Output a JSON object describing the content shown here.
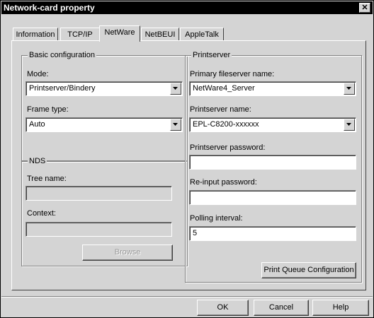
{
  "window": {
    "title": "Network-card property",
    "close_label": "✕"
  },
  "tabs": [
    {
      "label": "Information"
    },
    {
      "label": "TCP/IP"
    },
    {
      "label": "NetWare"
    },
    {
      "label": "NetBEUI"
    },
    {
      "label": "AppleTalk"
    }
  ],
  "active_tab": "NetWare",
  "basic": {
    "group_label": "Basic configuration",
    "mode_label": "Mode:",
    "mode_value": "Printserver/Bindery",
    "frame_label": "Frame type:",
    "frame_value": "Auto"
  },
  "nds": {
    "group_label": "NDS",
    "tree_label": "Tree name:",
    "tree_value": "",
    "context_label": "Context:",
    "context_value": "",
    "browse_label": "Browse"
  },
  "printserver": {
    "group_label": "Printserver",
    "primary_label": "Primary fileserver name:",
    "primary_value": "NetWare4_Server",
    "name_label": "Printserver name:",
    "name_value": "EPL-C8200-xxxxxx",
    "password_label": "Printserver password:",
    "password_value": "",
    "reinput_label": "Re-input password:",
    "reinput_value": "",
    "polling_label": "Polling interval:",
    "polling_value": "5",
    "queue_button": "Print Queue Configuration"
  },
  "footer": {
    "ok": "OK",
    "cancel": "Cancel",
    "help": "Help"
  }
}
